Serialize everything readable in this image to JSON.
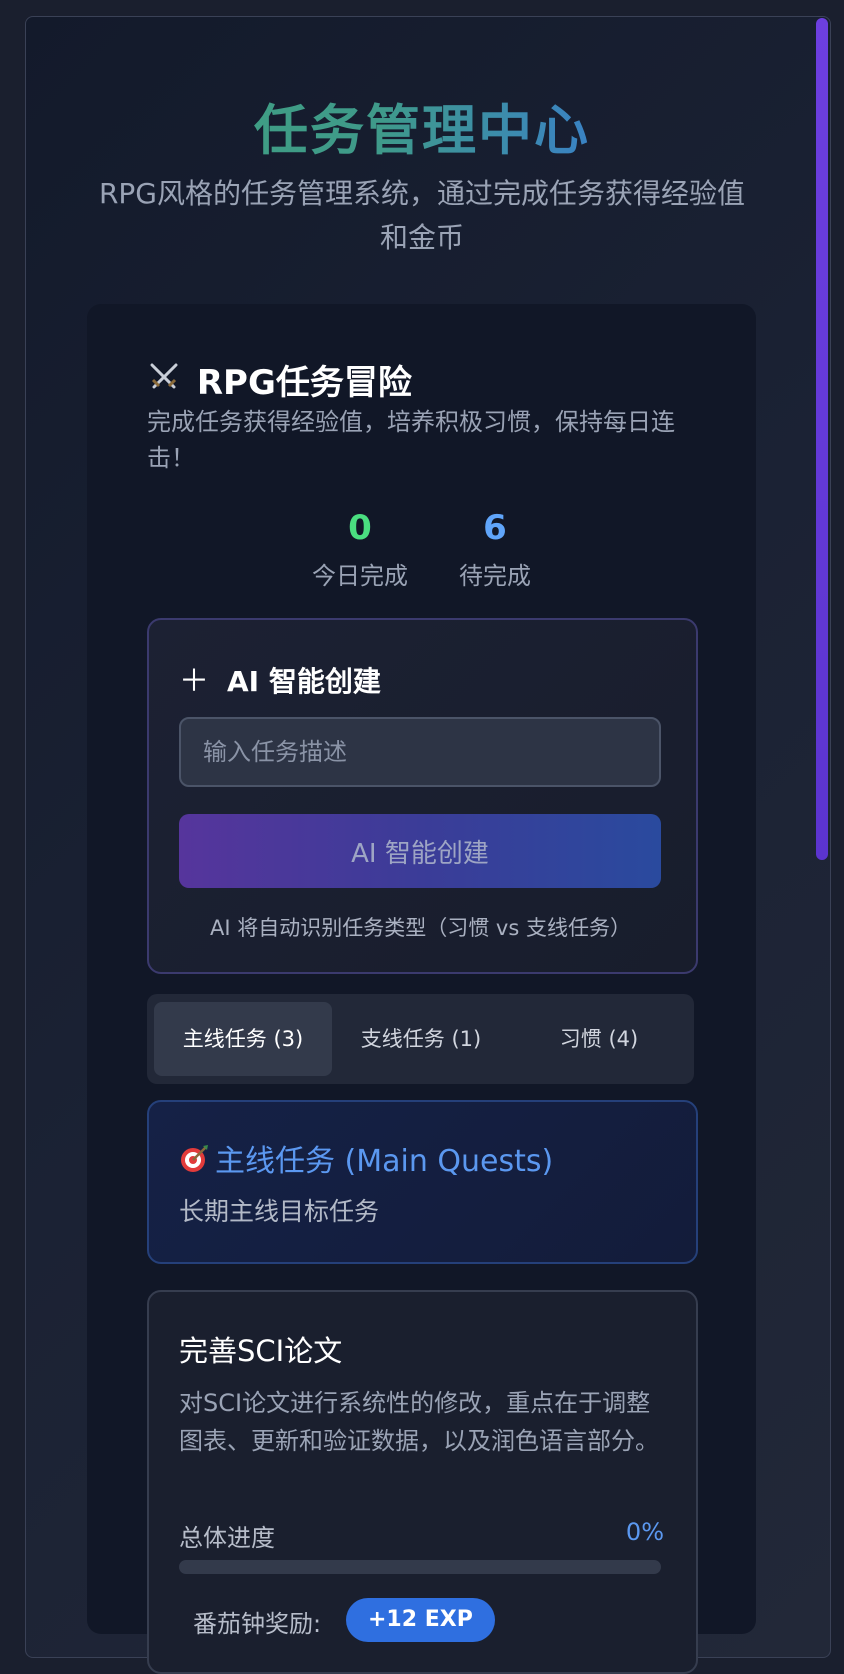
{
  "hero": {
    "title": "任务管理中心",
    "subtitle": "RPG风格的任务管理系统，通过完成任务获得经验值和金币"
  },
  "quest_panel": {
    "icon": "crossed-swords-icon",
    "title": "RPG任务冒险",
    "description": "完成任务获得经验值，培养积极习惯，保持每日连击！",
    "stats": [
      {
        "value": "0",
        "label": "今日完成",
        "color": "#4ade80"
      },
      {
        "value": "6",
        "label": "待完成",
        "color": "#60a5fa"
      }
    ]
  },
  "ai_create": {
    "icon": "plus-icon",
    "heading": "AI 智能创建",
    "input_placeholder": "输入任务描述",
    "button_label": "AI 智能创建",
    "hint": "AI 将自动识别任务类型（习惯 vs 支线任务）"
  },
  "tabs": [
    {
      "label": "主线任务 (3)",
      "active": true
    },
    {
      "label": "支线任务 (1)",
      "active": false
    },
    {
      "label": "习惯 (4)",
      "active": false
    }
  ],
  "main_section": {
    "icon": "target-icon",
    "title": "主线任务 (Main Quests)",
    "subtitle": "长期主线目标任务"
  },
  "task": {
    "title": "完善SCI论文",
    "description": "对SCI论文进行系统性的修改，重点在于调整图表、更新和验证数据，以及润色语言部分。",
    "progress_label": "总体进度",
    "progress_text": "0%",
    "progress": 0,
    "reward_label": "番茄钟奖励:",
    "reward_badge": "+12 EXP"
  },
  "colors": {
    "accent_blue": "#5b98f0",
    "accent_purple": "#6d3fe0",
    "background": "#1a1f2e"
  }
}
